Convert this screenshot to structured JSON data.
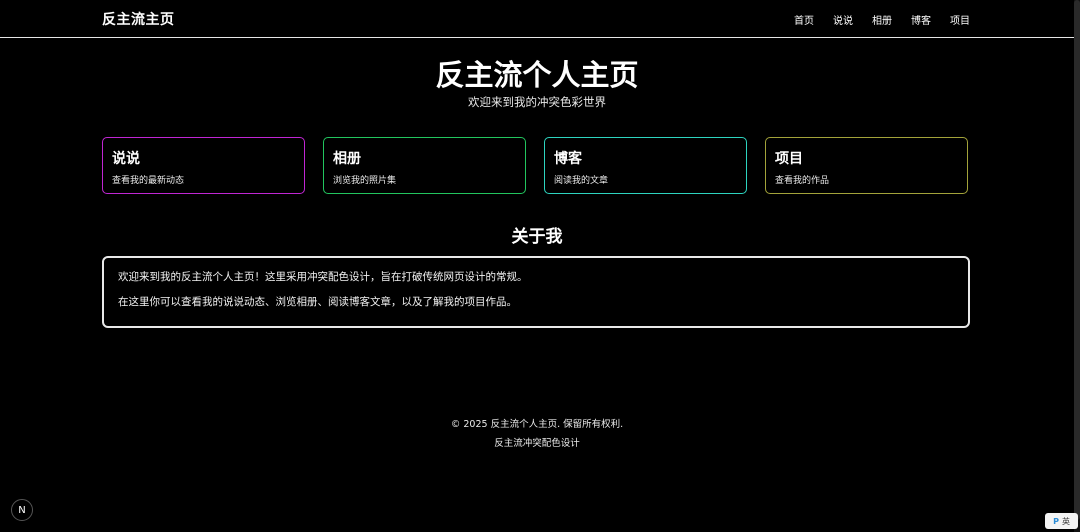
{
  "header": {
    "brand": "反主流主页",
    "nav": [
      "首页",
      "说说",
      "相册",
      "博客",
      "项目"
    ]
  },
  "hero": {
    "title": "反主流个人主页",
    "subtitle": "欢迎来到我的冲突色彩世界"
  },
  "cards": [
    {
      "title": "说说",
      "desc": "查看我的最新动态",
      "border_color": "#c026d3"
    },
    {
      "title": "相册",
      "desc": "浏览我的照片集",
      "border_color": "#22c55e"
    },
    {
      "title": "博客",
      "desc": "阅读我的文章",
      "border_color": "#2dd4bf"
    },
    {
      "title": "项目",
      "desc": "查看我的作品",
      "border_color": "#a3a33a"
    }
  ],
  "about": {
    "title": "关于我",
    "paragraphs": [
      "欢迎来到我的反主流个人主页！这里采用冲突配色设计，旨在打破传统网页设计的常规。",
      "在这里你可以查看我的说说动态、浏览相册、阅读博客文章，以及了解我的项目作品。"
    ]
  },
  "footer": {
    "copyright": "© 2025 反主流个人主页. 保留所有权利.",
    "tagline": "反主流冲突配色设计"
  },
  "badge": {
    "letter": "N"
  },
  "lang_widget": {
    "icon": "P",
    "label": "英"
  }
}
